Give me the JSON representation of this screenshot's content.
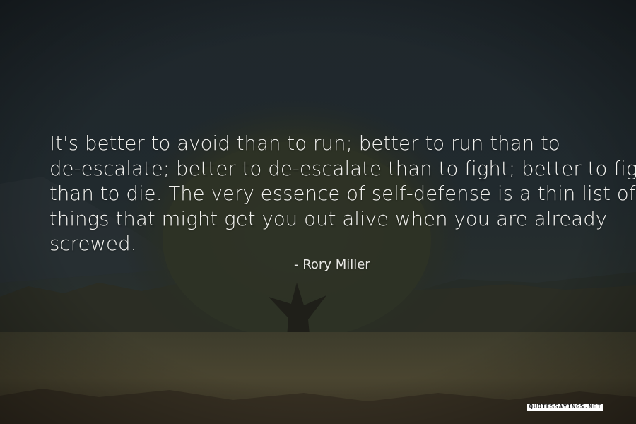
{
  "quote": {
    "lines": [
      "It's better to avoid than to run; better to run than to",
      "de-escalate; better to de-escalate than to fight; better to fight",
      "than to die. The very essence of self-defense is a thin list of",
      "things that might get you out alive when you are already",
      "screwed."
    ],
    "author": "- Rory Miller"
  },
  "watermark": "QUOTESSAYINGS.NET",
  "colors": {
    "sky": "#1e272c",
    "text": "#f1f1ee",
    "foliage": "#2f3526",
    "field": "#4a4530"
  }
}
